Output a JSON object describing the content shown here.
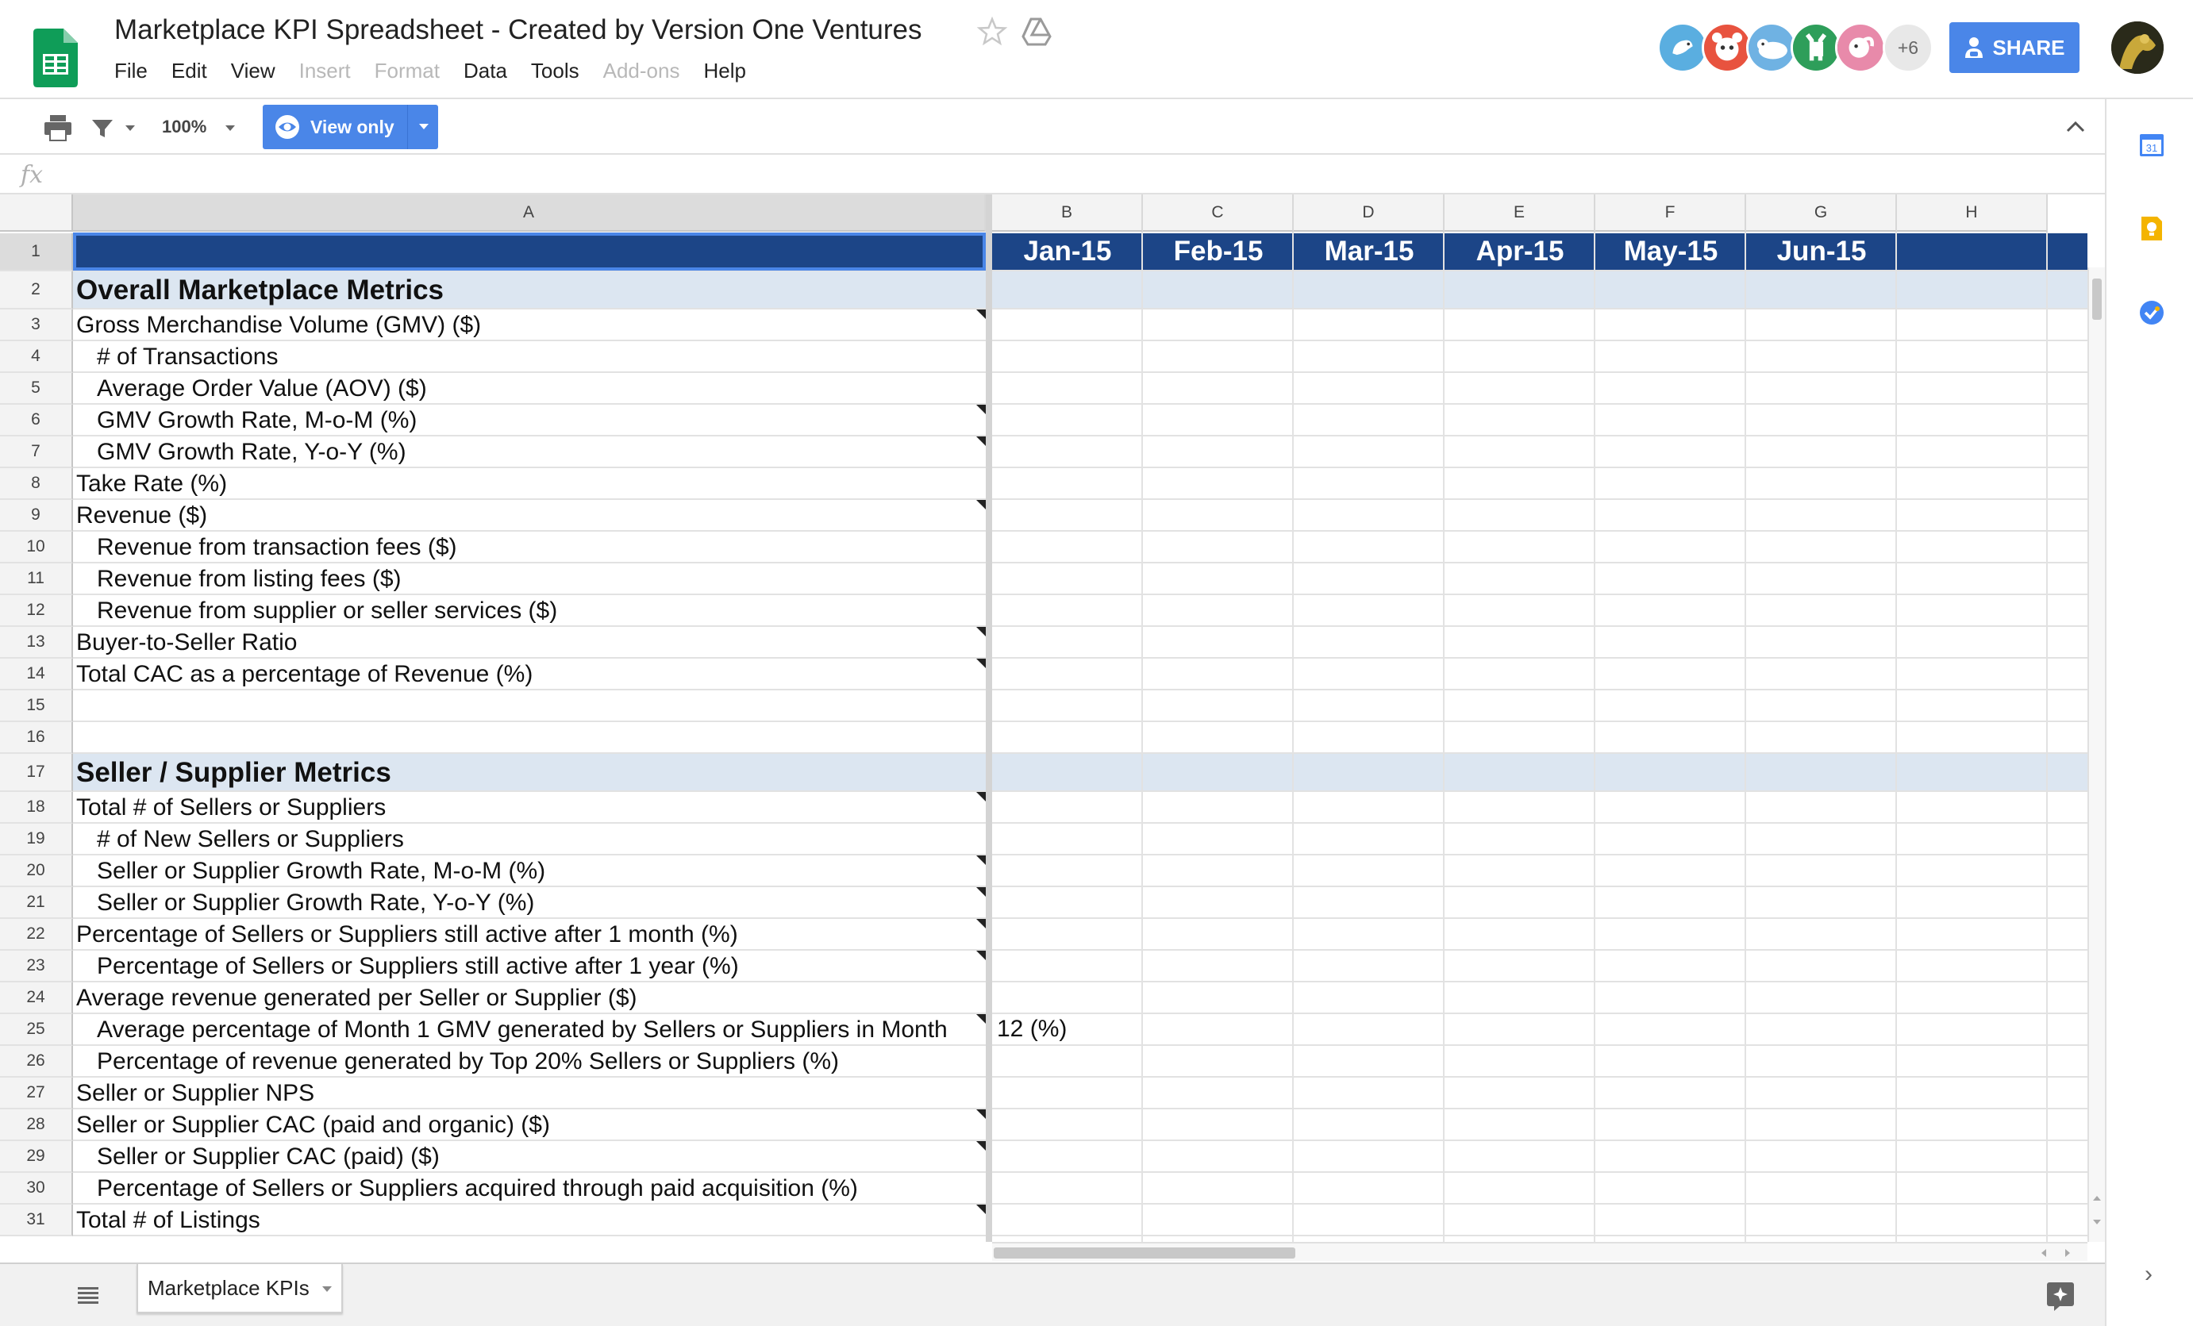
{
  "document": {
    "title": "Marketplace KPI Spreadsheet - Created by Version One Ventures"
  },
  "menu": [
    {
      "label": "File",
      "enabled": true
    },
    {
      "label": "Edit",
      "enabled": true
    },
    {
      "label": "View",
      "enabled": true
    },
    {
      "label": "Insert",
      "enabled": false
    },
    {
      "label": "Format",
      "enabled": false
    },
    {
      "label": "Data",
      "enabled": true
    },
    {
      "label": "Tools",
      "enabled": true
    },
    {
      "label": "Add-ons",
      "enabled": false
    },
    {
      "label": "Help",
      "enabled": true
    }
  ],
  "collaborators": {
    "more_count": "+6",
    "colors": [
      "#5aaee0",
      "#e8533f",
      "#6fb2e3",
      "#2e9e5a",
      "#e88aaa"
    ]
  },
  "share": {
    "label": "SHARE"
  },
  "toolbar": {
    "zoom": "100%",
    "mode_label": "View only"
  },
  "formula_bar": {
    "fx": "fx",
    "value": ""
  },
  "columns": [
    "A",
    "B",
    "C",
    "D",
    "E",
    "F",
    "G",
    "H"
  ],
  "months": [
    "Jan-15",
    "Feb-15",
    "Mar-15",
    "Apr-15",
    "May-15",
    "Jun-15",
    ""
  ],
  "rows": [
    {
      "num": "1",
      "label": ""
    },
    {
      "num": "2",
      "label": "Overall Marketplace Metrics",
      "section": true
    },
    {
      "num": "3",
      "label": "Gross Merchandise Volume (GMV) ($)",
      "note": true
    },
    {
      "num": "4",
      "label": "# of Transactions",
      "indent": true
    },
    {
      "num": "5",
      "label": "Average Order Value (AOV) ($)",
      "indent": true
    },
    {
      "num": "6",
      "label": "GMV Growth Rate, M-o-M (%)",
      "indent": true,
      "note": true
    },
    {
      "num": "7",
      "label": "GMV Growth Rate, Y-o-Y (%)",
      "indent": true,
      "note": true
    },
    {
      "num": "8",
      "label": "Take Rate (%)"
    },
    {
      "num": "9",
      "label": "Revenue ($)",
      "note": true
    },
    {
      "num": "10",
      "label": "Revenue from transaction fees ($)",
      "indent": true
    },
    {
      "num": "11",
      "label": "Revenue from listing fees ($)",
      "indent": true
    },
    {
      "num": "12",
      "label": "Revenue from supplier or seller services ($)",
      "indent": true
    },
    {
      "num": "13",
      "label": "Buyer-to-Seller Ratio",
      "note": true
    },
    {
      "num": "14",
      "label": "Total CAC as a percentage of Revenue (%)",
      "note": true
    },
    {
      "num": "15",
      "label": ""
    },
    {
      "num": "16",
      "label": ""
    },
    {
      "num": "17",
      "label": "Seller / Supplier Metrics",
      "section": true
    },
    {
      "num": "18",
      "label": "Total # of Sellers or Suppliers",
      "note": true
    },
    {
      "num": "19",
      "label": "# of New Sellers or Suppliers",
      "indent": true
    },
    {
      "num": "20",
      "label": "Seller or Supplier Growth Rate, M-o-M (%)",
      "indent": true,
      "note": true
    },
    {
      "num": "21",
      "label": "Seller or Supplier Growth Rate, Y-o-Y (%)",
      "indent": true,
      "note": true
    },
    {
      "num": "22",
      "label": "Percentage of Sellers or Suppliers still active after 1 month (%)",
      "note": true
    },
    {
      "num": "23",
      "label": "Percentage of Sellers or Suppliers still active after 1 year (%)",
      "indent": true,
      "note": true
    },
    {
      "num": "24",
      "label": "Average revenue generated per Seller or Supplier ($)"
    },
    {
      "num": "25",
      "label": "Average percentage of Month 1 GMV generated by Sellers or Suppliers in Month",
      "indent": true,
      "note": true,
      "overflow": "12 (%)"
    },
    {
      "num": "26",
      "label": "Percentage of revenue generated by Top 20% Sellers or Suppliers (%)",
      "indent": true
    },
    {
      "num": "27",
      "label": "Seller or Supplier NPS"
    },
    {
      "num": "28",
      "label": "Seller or Supplier CAC (paid and organic) ($)",
      "note": true
    },
    {
      "num": "29",
      "label": "Seller or Supplier CAC (paid) ($)",
      "indent": true,
      "note": true
    },
    {
      "num": "30",
      "label": "Percentage of Sellers or Suppliers acquired through paid acquisition (%)",
      "indent": true
    },
    {
      "num": "31",
      "label": "Total # of Listings",
      "note": true
    }
  ],
  "sheet_tabs": [
    {
      "label": "Marketplace KPIs",
      "active": true
    }
  ],
  "colors": {
    "accent": "#4a86e8",
    "header_band": "#1c4587",
    "section_band": "#dce6f1",
    "sheets_green": "#0f9d58"
  }
}
